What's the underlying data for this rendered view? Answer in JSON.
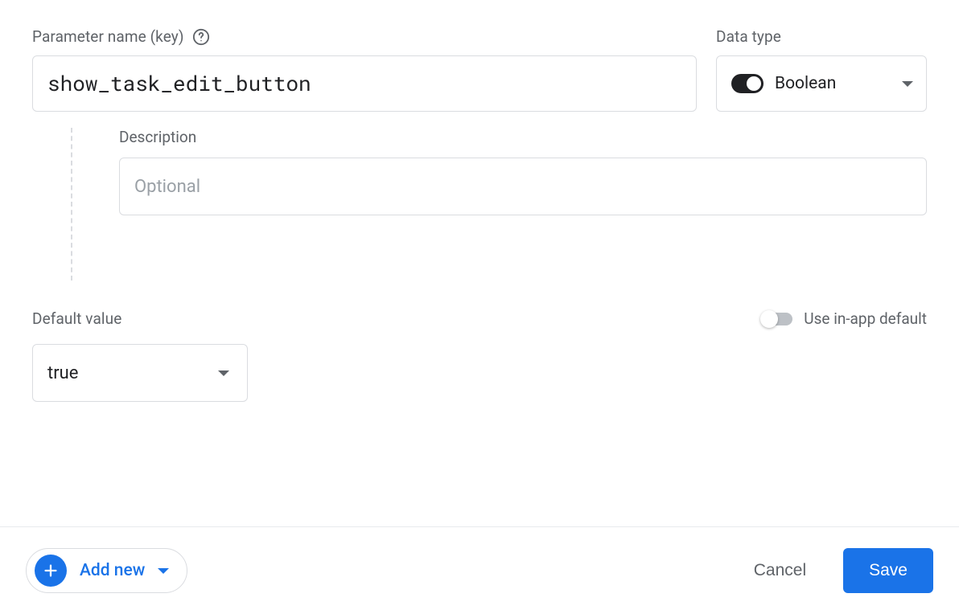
{
  "parameter": {
    "name_label": "Parameter name (key)",
    "name_value": "show_task_edit_button"
  },
  "data_type": {
    "label": "Data type",
    "selected": "Boolean",
    "toggle_on": true
  },
  "description": {
    "label": "Description",
    "placeholder": "Optional",
    "value": ""
  },
  "default_value": {
    "label": "Default value",
    "selected": "true"
  },
  "use_in_app_default": {
    "label": "Use in-app default",
    "enabled": false
  },
  "footer": {
    "add_new": "Add new",
    "cancel": "Cancel",
    "save": "Save"
  }
}
